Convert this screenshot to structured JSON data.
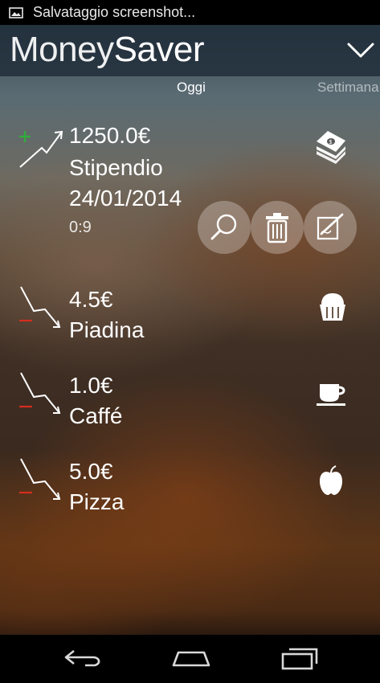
{
  "status_bar": {
    "notification_text": "Salvataggio screenshot...",
    "icon": "image-icon"
  },
  "app_bar": {
    "title_part1": "Money",
    "title_part2": "Saver",
    "menu_icon": "chevron-down-icon"
  },
  "tabs": [
    {
      "label": "Oggi",
      "active": true
    },
    {
      "label": "Settimana",
      "active": false
    }
  ],
  "transactions": [
    {
      "amount": "1250.0€",
      "name": "Stipendio",
      "date": "24/01/2014",
      "time": "0:9",
      "type": "income",
      "category_icon": "money-stack-icon"
    },
    {
      "amount": "4.5€",
      "name": "Piadina",
      "type": "expense",
      "category_icon": "cupcake-icon"
    },
    {
      "amount": "1.0€",
      "name": "Caffé",
      "type": "expense",
      "category_icon": "coffee-cup-icon"
    },
    {
      "amount": "5.0€",
      "name": "Pizza",
      "type": "expense",
      "category_icon": "apple-icon"
    }
  ],
  "actions": [
    {
      "name": "search",
      "icon": "search-icon"
    },
    {
      "name": "delete",
      "icon": "trash-icon"
    },
    {
      "name": "edit",
      "icon": "edit-icon"
    }
  ],
  "colors": {
    "income_sign": "#2fae3a",
    "expense_sign": "#d62d20",
    "app_bar": "#1e2a37",
    "status_bar": "#000000"
  },
  "nav_bar": {
    "buttons": [
      "back-icon",
      "home-icon",
      "recent-apps-icon"
    ]
  }
}
